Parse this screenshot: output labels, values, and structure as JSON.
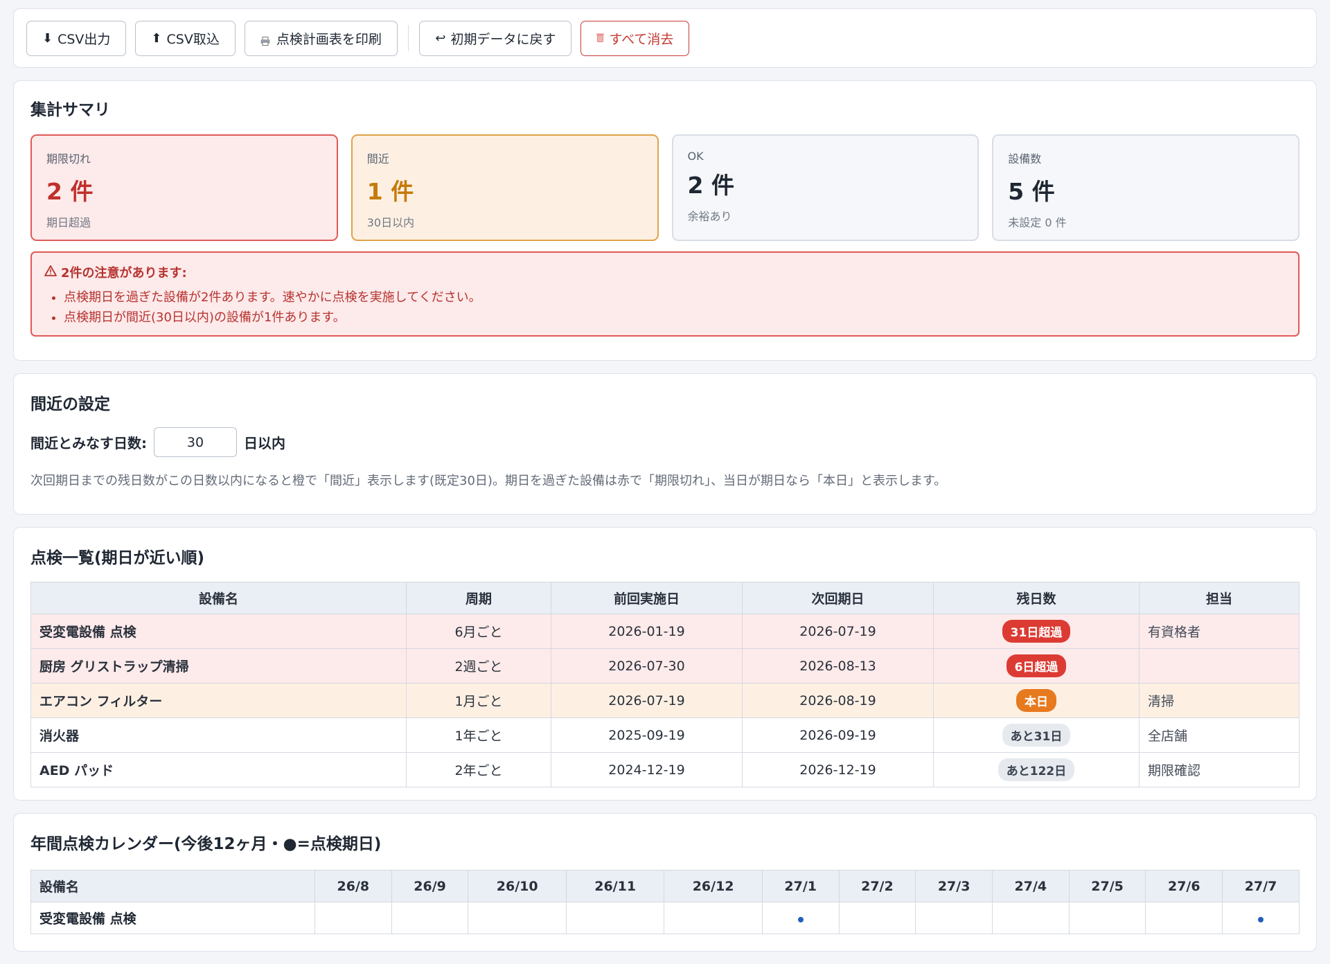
{
  "toolbar": {
    "csv_export": "CSV出力",
    "csv_import": "CSV取込",
    "print": "点検計画表を印刷",
    "reset": "初期データに戻す",
    "clear": "すべて消去"
  },
  "summary": {
    "title": "集計サマリ",
    "overdue": {
      "label": "期限切れ",
      "value": "2 件",
      "sub": "期日超過"
    },
    "near": {
      "label": "間近",
      "value": "1 件",
      "sub": "30日以内"
    },
    "ok": {
      "label": "OK",
      "value": "2 件",
      "sub": "余裕あり"
    },
    "total": {
      "label": "設備数",
      "value": "5 件",
      "sub": "未設定 0 件"
    },
    "alert": {
      "title": "2件の注意があります:",
      "items": [
        "点検期日を過ぎた設備が2件あります。速やかに点検を実施してください。",
        "点検期日が間近(30日以内)の設備が1件あります。"
      ]
    }
  },
  "settings": {
    "title": "間近の設定",
    "label": "間近とみなす日数:",
    "value": "30",
    "suffix": "日以内",
    "help": "次回期日までの残日数がこの日数以内になると橙で「間近」表示します(既定30日)。期日を過ぎた設備は赤で「期限切れ」、当日が期日なら「本日」と表示します。"
  },
  "list": {
    "title": "点検一覧(期日が近い順)",
    "headers": [
      "設備名",
      "周期",
      "前回実施日",
      "次回期日",
      "残日数",
      "担当"
    ],
    "rows": [
      {
        "name": "受変電設備 点検",
        "cycle": "6月ごと",
        "last": "2026-01-19",
        "next": "2026-07-19",
        "remain": "31日超過",
        "owner": "有資格者",
        "status": "overdue"
      },
      {
        "name": "厨房 グリストラップ清掃",
        "cycle": "2週ごと",
        "last": "2026-07-30",
        "next": "2026-08-13",
        "remain": "6日超過",
        "owner": "",
        "status": "overdue"
      },
      {
        "name": "エアコン フィルター",
        "cycle": "1月ごと",
        "last": "2026-07-19",
        "next": "2026-08-19",
        "remain": "本日",
        "owner": "清掃",
        "status": "today"
      },
      {
        "name": "消火器",
        "cycle": "1年ごと",
        "last": "2025-09-19",
        "next": "2026-09-19",
        "remain": "あと31日",
        "owner": "全店舗",
        "status": "ok"
      },
      {
        "name": "AED パッド",
        "cycle": "2年ごと",
        "last": "2024-12-19",
        "next": "2026-12-19",
        "remain": "あと122日",
        "owner": "期限確認",
        "status": "ok"
      }
    ],
    "colors": {
      "overdue": "#dc3b33",
      "today": "#e7791f",
      "ok": "#e6eaef"
    }
  },
  "calendar": {
    "title": "年間点検カレンダー(今後12ヶ月・●=点検期日)",
    "first_header": "設備名",
    "months": [
      "26/8",
      "26/9",
      "26/10",
      "26/11",
      "26/12",
      "27/1",
      "27/2",
      "27/3",
      "27/4",
      "27/5",
      "27/6",
      "27/7"
    ],
    "rows": [
      {
        "name": "受変電設備 点検",
        "marks": [
          false,
          false,
          false,
          false,
          false,
          true,
          false,
          false,
          false,
          false,
          false,
          true
        ]
      }
    ]
  }
}
